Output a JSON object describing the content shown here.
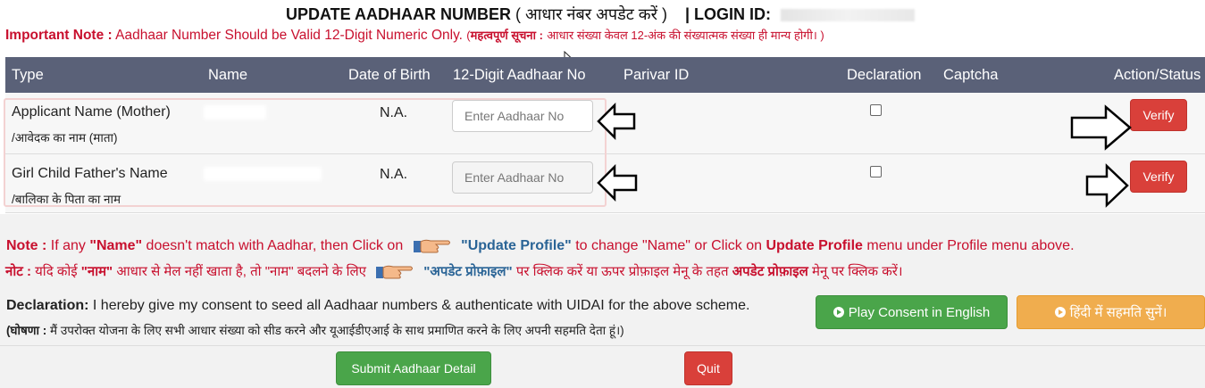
{
  "header": {
    "title": "UPDATE AADHAAR NUMBER",
    "title_hindi": "( आधार नंबर अपडेट करें )",
    "login_label": "| LOGIN ID:"
  },
  "important_note": {
    "label": "Important Note :",
    "text": "Aadhaar Number Should be Valid 12-Digit Numeric Only.",
    "hindi_open": "(",
    "hindi_label": "महत्वपूर्ण सूचना :",
    "hindi_text": "आधार संख्या केवल 12-अंक की संख्यात्मक संख्या ही मान्य होगी। )"
  },
  "table": {
    "columns": [
      "Type",
      "Name",
      "Date of Birth",
      "12-Digit Aadhaar No",
      "Parivar ID",
      "Declaration",
      "Captcha",
      "Action/Status"
    ],
    "rows": [
      {
        "type_en": "Applicant Name (Mother)",
        "type_hi": "/आवेदक का नाम (माता)",
        "dob": "N.A.",
        "aadhaar_placeholder": "Enter Aadhaar No",
        "verify_label": "Verify"
      },
      {
        "type_en": "Girl Child Father's Name",
        "type_hi": "/बालिका के पिता का नाम",
        "dob": "N.A.",
        "aadhaar_placeholder": "Enter Aadhaar No",
        "verify_label": "Verify"
      }
    ]
  },
  "note_en": {
    "label": "Note :",
    "part1": " If any ",
    "name_word": "\"Name\"",
    "part2": " doesn't match with Aadhar, then Click on",
    "link": "\"Update Profile\"",
    "part3": " to change \"Name\" or Click on ",
    "menu": "Update Profile",
    "part4": " menu under Profile menu above."
  },
  "note_hi": {
    "label": "नोट :",
    "part1": " यदि कोई ",
    "name_word": "\"नाम\"",
    "part2": " आधार से मेल नहीं खाता है, तो \"नाम\" बदलने के लिए",
    "link": "\"अपडेट प्रोफ़ाइल\"",
    "part3": " पर क्लिक करें या ऊपर प्रोफ़ाइल मेनू के तहत ",
    "menu": "अपडेट प्रोफ़ाइल",
    "part4": " मेनू पर क्लिक करें।"
  },
  "declaration": {
    "label_en": "Declaration:",
    "text_en": " I hereby give my consent to seed all Aadhaar numbers & authenticate with UIDAI for the above scheme.",
    "label_hi": "(घोषणा :",
    "text_hi": " मैं उपरोक्त योजना के लिए सभी आधार संख्या को सीड करने और यूआईडीएआई के साथ प्रमाणित करने के लिए अपनी सहमति देता हूं।)"
  },
  "buttons": {
    "play_english": "Play Consent in English",
    "play_hindi": "हिंदी में सहमति सुनें।",
    "submit": "Submit Aadhaar Detail",
    "quit": "Quit"
  },
  "colors": {
    "header_bg": "#5a6178",
    "red_text": "#c8102e",
    "verify_red": "#d9403a",
    "green": "#4aa54a",
    "orange": "#f0ad4e",
    "link_blue": "#2a6496"
  }
}
